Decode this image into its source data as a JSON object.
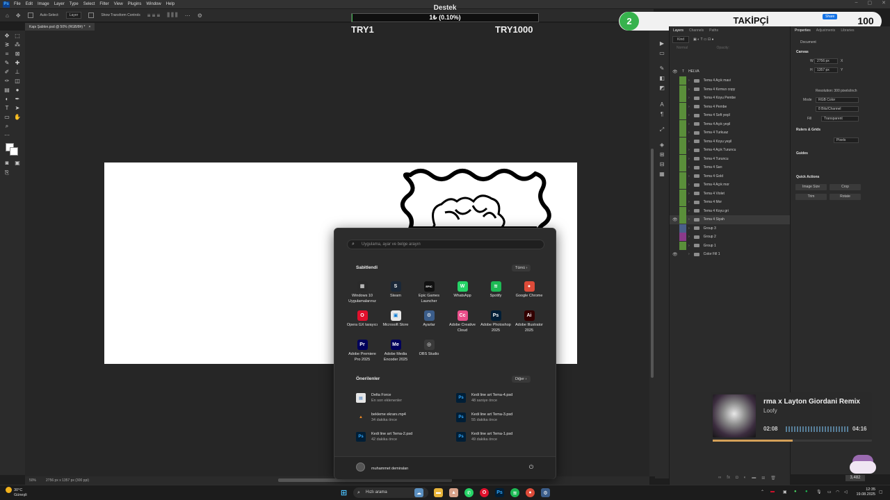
{
  "menubar": {
    "app_logo": "Ps",
    "items": [
      "File",
      "Edit",
      "Image",
      "Layer",
      "Type",
      "Select",
      "Filter",
      "View",
      "Plugins",
      "Window",
      "Help"
    ]
  },
  "options_bar": {
    "auto_select": "Auto-Select:",
    "layer_select": "Layer",
    "show_transform": "Show Transform Controls"
  },
  "document": {
    "tab_title": "Kapı Şablon.psd @ 50% (RGB/8#) *",
    "zoom": "50%",
    "size_info": "2756 px x 1357 px (300 ppi)"
  },
  "donation": {
    "title": "Destek",
    "progress_text": "1₺ (0.10%)",
    "progress_percent": 0.1,
    "min_label": "TRY1",
    "max_label": "TRY1000",
    "fill_color": "#3ab54a"
  },
  "followers": {
    "current": "2",
    "label": "TAKİPÇİ",
    "goal": "100",
    "accent": "#37b24d"
  },
  "layers_panel": {
    "tabs": [
      "Layers",
      "Channels",
      "Paths"
    ],
    "kind": "Kind",
    "mode": "Normal",
    "opacity": "Opacity:",
    "text_layer": "HELVA",
    "layers": [
      {
        "name": "Tema 4 Açık mavi",
        "tag": "#5a8f3a",
        "eye": false
      },
      {
        "name": "Tema 4 Kırmızı copy",
        "tag": "#5a8f3a",
        "eye": false
      },
      {
        "name": "Tema 4 Koyu Pembe",
        "tag": "#5a8f3a",
        "eye": false
      },
      {
        "name": "Tema 4 Pembe",
        "tag": "#5a8f3a",
        "eye": false
      },
      {
        "name": "Tema 4 Soft yeşil",
        "tag": "#5a8f3a",
        "eye": false
      },
      {
        "name": "Tema 4 Açık yeşil",
        "tag": "#5a8f3a",
        "eye": false
      },
      {
        "name": "Tema 4 Turkuaz",
        "tag": "#5a8f3a",
        "eye": false
      },
      {
        "name": "Tema 4 Koyu yeşil",
        "tag": "#5a8f3a",
        "eye": false
      },
      {
        "name": "Tema 4 Açık Turuncu",
        "tag": "#5a8f3a",
        "eye": false
      },
      {
        "name": "Tema 4 Turuncu",
        "tag": "#5a8f3a",
        "eye": false
      },
      {
        "name": "Tema 4 Sarı",
        "tag": "#5a8f3a",
        "eye": false
      },
      {
        "name": "Tema 4 Gold",
        "tag": "#5a8f3a",
        "eye": false
      },
      {
        "name": "Tema 4 Açık mor",
        "tag": "#5a8f3a",
        "eye": false
      },
      {
        "name": "Tema 4 Violet",
        "tag": "#5a8f3a",
        "eye": false
      },
      {
        "name": "Tema 4 Mor",
        "tag": "#5a8f3a",
        "eye": false
      },
      {
        "name": "Tema 4 Koyu gri",
        "tag": "#5a8f3a",
        "eye": false
      },
      {
        "name": "Tema 4 Siyah",
        "tag": "#5a8f3a",
        "eye": true
      },
      {
        "name": "Group 3",
        "tag": "#4a5f8a",
        "eye": false
      },
      {
        "name": "Group 2",
        "tag": "#8a3a8a",
        "eye": false
      },
      {
        "name": "Group 1",
        "tag": "#5a8f3a",
        "eye": false
      },
      {
        "name": "Color Fill 1",
        "tag": "#2b2b2b",
        "eye": true
      }
    ]
  },
  "properties": {
    "tabs": [
      "Properties",
      "Adjustments",
      "Libraries"
    ],
    "document": "Document",
    "canvas": "Canvas",
    "w": "W",
    "w_value": "2756 px",
    "h": "H",
    "h_value": "1357 px",
    "x": "X",
    "y": "Y",
    "resolution": "Resolution: 300 pixels/inch",
    "mode_label": "Mode",
    "mode_value": "RGB Color",
    "bit_value": "8 Bits/Channel",
    "fill_label": "Fill",
    "fill_value": "Transparent",
    "rulers_grids": "Rulers & Grids",
    "units": "Pixels",
    "guides": "Guides",
    "quick_actions": "Quick Actions",
    "image_size": "Image Size",
    "crop": "Crop",
    "trim": "Trim",
    "rotate": "Rotate",
    "share": "Share"
  },
  "start_menu": {
    "search_placeholder": "Uygulama, ayar ve belge arayın",
    "pinned_title": "Sabitlendi",
    "all_button": "Tümü",
    "pinned": [
      {
        "name": "Windows 10 Uygulamalarınız",
        "color": "#2a2a2a",
        "glyph": "▦"
      },
      {
        "name": "Steam",
        "color": "#1b2838",
        "glyph": "S"
      },
      {
        "name": "Epic Games Launcher",
        "color": "#111111",
        "glyph": "EPIC"
      },
      {
        "name": "WhatsApp",
        "color": "#25d366",
        "glyph": "W"
      },
      {
        "name": "Spotify",
        "color": "#1db954",
        "glyph": "≋"
      },
      {
        "name": "Google Chrome",
        "color": "#dd4b39",
        "glyph": "●"
      },
      {
        "name": "Opera GX tarayıcı",
        "color": "#e0102c",
        "glyph": "O"
      },
      {
        "name": "Microsoft Store",
        "color": "#e8e8e8",
        "glyph": "▣"
      },
      {
        "name": "Ayarlar",
        "color": "#3b5d8a",
        "glyph": "⚙"
      },
      {
        "name": "Adobe Creative Cloud",
        "color": "#e94e8a",
        "glyph": "Cc"
      },
      {
        "name": "Adobe Photoshop 2025",
        "color": "#001e36",
        "glyph": "Ps"
      },
      {
        "name": "Adobe Illustrator 2025",
        "color": "#330000",
        "glyph": "Ai"
      },
      {
        "name": "Adobe Premiere Pro 2025",
        "color": "#00005b",
        "glyph": "Pr"
      },
      {
        "name": "Adobe Media Encoder 2025",
        "color": "#00005b",
        "glyph": "Me"
      },
      {
        "name": "OBS Studio",
        "color": "#3a3a3a",
        "glyph": "◎"
      }
    ],
    "recommended_title": "Önerilenler",
    "more_button": "Diğer",
    "recommended": [
      {
        "name": "Delta Force",
        "sub": "En son eklenenler",
        "color": "#e6e6e6",
        "glyph": "▤"
      },
      {
        "name": "Kedi line art Tema-4.psd",
        "sub": "48 saniye önce",
        "color": "#001e36",
        "glyph": "Ps"
      },
      {
        "name": "bekleme ekranı.mp4",
        "sub": "34 dakika önce",
        "color": "#2c2c2c",
        "glyph": "▲"
      },
      {
        "name": "Kedi line art Tema-3.psd",
        "sub": "55 dakika önce",
        "color": "#001e36",
        "glyph": "Ps"
      },
      {
        "name": "Kedi line art Tema-2.psd",
        "sub": "42 dakika önce",
        "color": "#001e36",
        "glyph": "Ps"
      },
      {
        "name": "Kedi line art Tema-1.psd",
        "sub": "49 dakika önce",
        "color": "#001e36",
        "glyph": "Ps"
      }
    ],
    "user_name": "muhammet demiralan"
  },
  "music": {
    "title": "rma x Layton Giordani Remix",
    "artist": "Loofy",
    "elapsed": "02:08",
    "total": "04:16",
    "progress": 0.5,
    "bar_color": "#d4a058"
  },
  "mascot": {
    "count": "3,482"
  },
  "taskbar": {
    "temp": "30°C",
    "condition": "Güneşli",
    "search": "Hızlı arama",
    "time": "12:35",
    "date": "19.08.2025"
  }
}
